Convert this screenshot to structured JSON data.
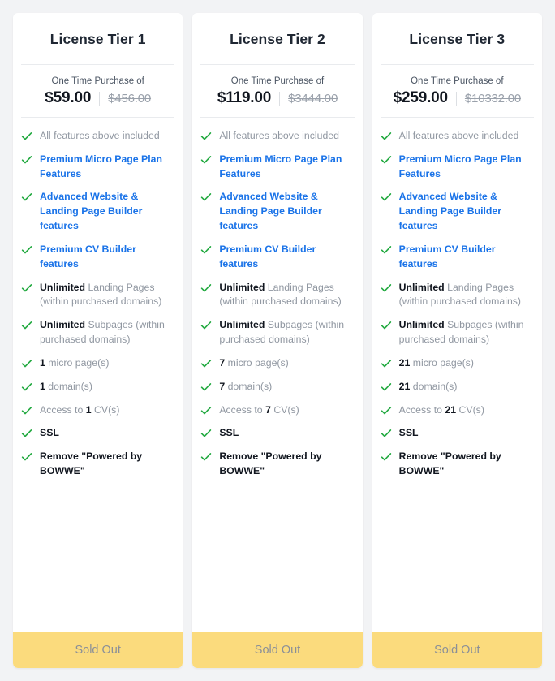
{
  "page": {
    "background_color": "#f2f3f5",
    "card_background": "#ffffff",
    "accent_blue": "#1a73e8",
    "check_green": "#21a93f",
    "button_color": "#fbdb7d",
    "button_text_color": "#8a8f98"
  },
  "icons": {
    "check": "check-icon"
  },
  "price_caption": "One Time Purchase of",
  "button_label": "Sold Out",
  "plans": [
    {
      "title": "License Tier 1",
      "price_caption": "One Time Purchase of",
      "price_current": "$59.00",
      "price_old": "$456.00",
      "button_label": "Sold Out",
      "features": [
        {
          "style": "gray",
          "text": "All features above included"
        },
        {
          "style": "blue",
          "text": "Premium Micro Page Plan Features"
        },
        {
          "style": "blue",
          "text": "Advanced Website & Landing Page Builder features"
        },
        {
          "style": "blue",
          "text": "Premium CV Builder features"
        },
        {
          "style": "mixed",
          "lead": "Unlimited",
          "text": " Landing Pages (within purchased domains)"
        },
        {
          "style": "mixed",
          "lead": "Unlimited",
          "text": " Subpages (within purchased domains)"
        },
        {
          "style": "mixed",
          "lead": "1",
          "text": " micro page(s)"
        },
        {
          "style": "mixed",
          "lead": "1",
          "text": " domain(s)"
        },
        {
          "style": "mixed-mid",
          "pre": "Access to ",
          "lead": "1",
          "text": " CV(s)"
        },
        {
          "style": "dark",
          "text": "SSL"
        },
        {
          "style": "dark",
          "text": "Remove \"Powered by BOWWE\""
        }
      ]
    },
    {
      "title": "License Tier 2",
      "price_caption": "One Time Purchase of",
      "price_current": "$119.00",
      "price_old": "$3444.00",
      "button_label": "Sold Out",
      "features": [
        {
          "style": "gray",
          "text": "All features above included"
        },
        {
          "style": "blue",
          "text": "Premium Micro Page Plan Features"
        },
        {
          "style": "blue",
          "text": "Advanced Website & Landing Page Builder features"
        },
        {
          "style": "blue",
          "text": "Premium CV Builder features"
        },
        {
          "style": "mixed",
          "lead": "Unlimited",
          "text": " Landing Pages (within purchased domains)"
        },
        {
          "style": "mixed",
          "lead": "Unlimited",
          "text": " Subpages (within purchased domains)"
        },
        {
          "style": "mixed",
          "lead": "7",
          "text": " micro page(s)"
        },
        {
          "style": "mixed",
          "lead": "7",
          "text": " domain(s)"
        },
        {
          "style": "mixed-mid",
          "pre": "Access to ",
          "lead": "7",
          "text": " CV(s)"
        },
        {
          "style": "dark",
          "text": "SSL"
        },
        {
          "style": "dark",
          "text": "Remove \"Powered by BOWWE\""
        }
      ]
    },
    {
      "title": "License Tier 3",
      "price_caption": "One Time Purchase of",
      "price_current": "$259.00",
      "price_old": "$10332.00",
      "button_label": "Sold Out",
      "features": [
        {
          "style": "gray",
          "text": "All features above included"
        },
        {
          "style": "blue",
          "text": "Premium Micro Page Plan Features"
        },
        {
          "style": "blue",
          "text": "Advanced Website & Landing Page Builder features"
        },
        {
          "style": "blue",
          "text": "Premium CV Builder features"
        },
        {
          "style": "mixed",
          "lead": "Unlimited",
          "text": " Landing Pages (within purchased domains)"
        },
        {
          "style": "mixed",
          "lead": "Unlimited",
          "text": " Subpages (within purchased domains)"
        },
        {
          "style": "mixed",
          "lead": "21",
          "text": " micro page(s)"
        },
        {
          "style": "mixed",
          "lead": "21",
          "text": " domain(s)"
        },
        {
          "style": "mixed-mid",
          "pre": "Access to ",
          "lead": "21",
          "text": " CV(s)"
        },
        {
          "style": "dark",
          "text": "SSL"
        },
        {
          "style": "dark",
          "text": "Remove \"Powered by BOWWE\""
        }
      ]
    }
  ]
}
